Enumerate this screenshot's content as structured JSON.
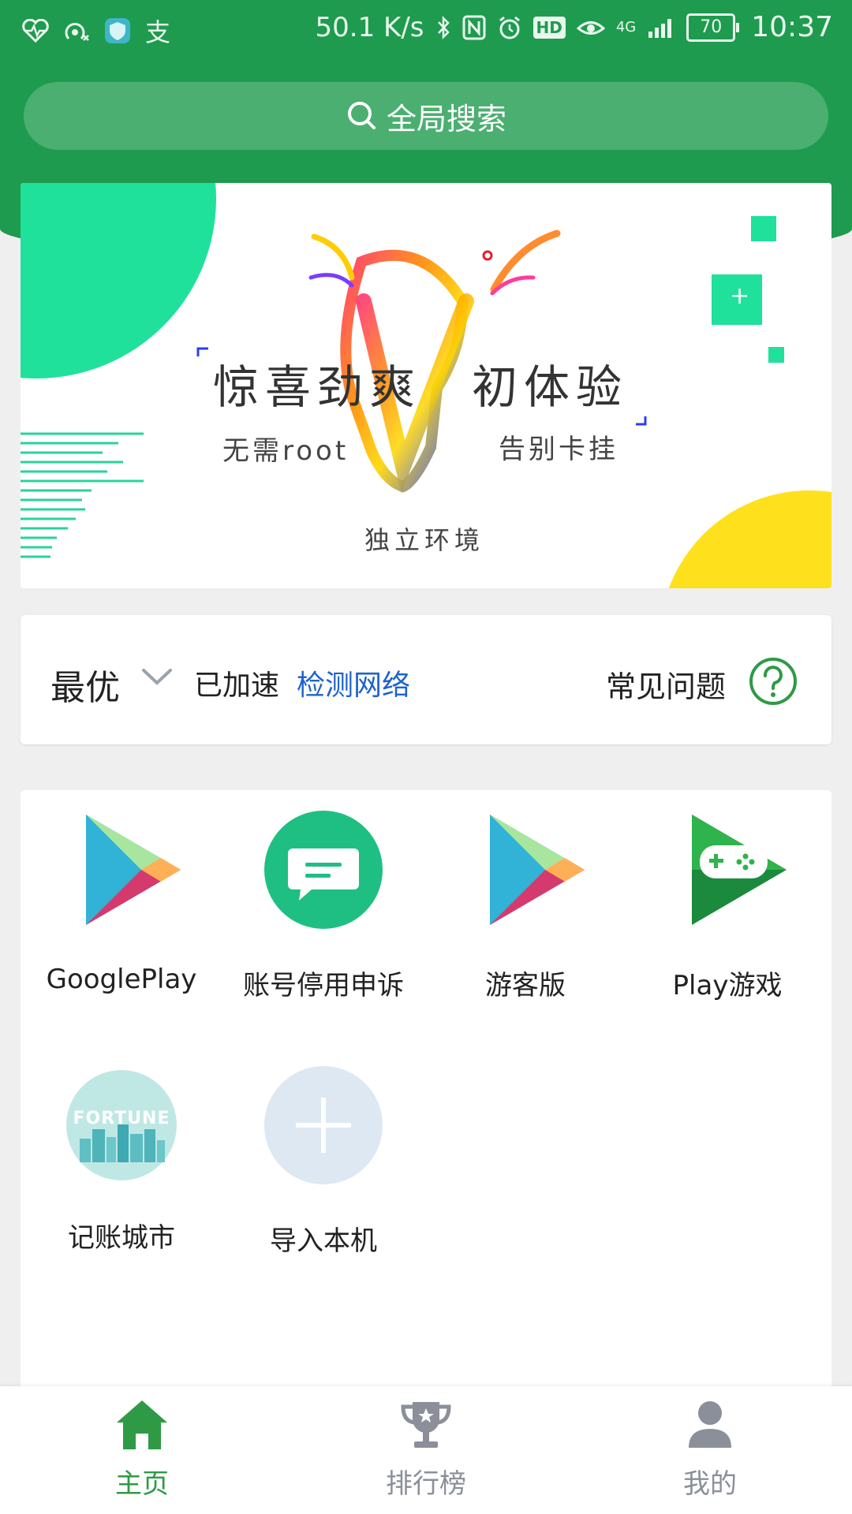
{
  "status_bar": {
    "speed": "50.1 K/s",
    "battery": "70",
    "time": "10:37",
    "net_type": "4G",
    "hd": "HD",
    "left_icons": [
      "heart-rate-icon",
      "hotspot-icon",
      "shield-app-icon",
      "alipay-icon"
    ],
    "alipay_glyph": "支"
  },
  "search": {
    "label": "全局搜索"
  },
  "banner": {
    "headline_left": "惊喜劲爽",
    "headline_right": "初体验",
    "tag_left": "无需root",
    "tag_right": "告别卡挂",
    "tag_bottom": "独立环境",
    "plus": "+"
  },
  "network": {
    "mode": "最优",
    "status": "已加速",
    "check_link": "检测网络",
    "faq": "常见问题"
  },
  "apps": [
    {
      "label": "GooglePlay",
      "icon": "google-play-icon"
    },
    {
      "label": "账号停用申诉",
      "icon": "chat-bubble-icon"
    },
    {
      "label": "游客版",
      "icon": "google-play-icon"
    },
    {
      "label": "Play游戏",
      "icon": "play-games-icon"
    },
    {
      "label": "记账城市",
      "icon": "fortune-city-icon",
      "icon_text": "FORTUNE"
    },
    {
      "label": "导入本机",
      "icon": "add-icon"
    }
  ],
  "bottom_nav": [
    {
      "label": "主页",
      "icon": "home-icon",
      "active": true
    },
    {
      "label": "排行榜",
      "icon": "trophy-icon",
      "active": false
    },
    {
      "label": "我的",
      "icon": "person-icon",
      "active": false
    }
  ],
  "colors": {
    "brand_green": "#1e9b4e",
    "link_blue": "#1e63c9",
    "nav_active": "#2e9a45",
    "nav_inactive": "#8a8f99"
  }
}
